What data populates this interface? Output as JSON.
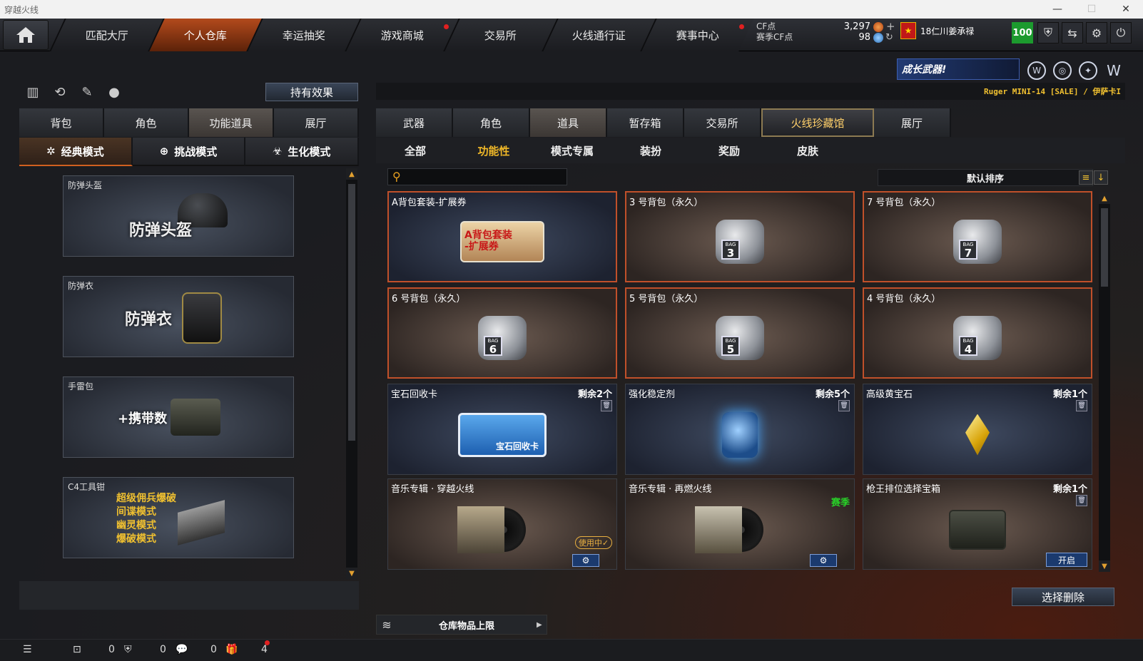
{
  "window": {
    "title": "穿越火线",
    "min": "—",
    "max": "☐",
    "close": "✕"
  },
  "nav": {
    "tabs": [
      "匹配大厅",
      "个人仓库",
      "幸运抽奖",
      "游戏商城",
      "交易所",
      "火线通行证",
      "赛事中心"
    ],
    "active_index": 1
  },
  "currency": {
    "cf_label": "CF点",
    "cf_value": "3,297",
    "season_label": "赛季CF点",
    "season_value": "98"
  },
  "player": {
    "rank_name": "18仁川姜承禄",
    "level": "100"
  },
  "left": {
    "effect_button": "持有效果",
    "tabs": [
      "背包",
      "角色",
      "功能道具",
      "展厅"
    ],
    "active_tab": 2,
    "modes": [
      "经典模式",
      "挑战模式",
      "生化模式"
    ],
    "active_mode": 0,
    "cards": [
      {
        "caption": "防弹头盔",
        "text": "防弹头盔"
      },
      {
        "caption": "防弹衣",
        "text": "防弹衣"
      },
      {
        "caption": "手雷包",
        "text": "+携带数"
      },
      {
        "caption": "C4工具钳",
        "lines": [
          "超级佣兵爆破",
          "间谍模式",
          "幽灵模式",
          "爆破模式"
        ]
      }
    ]
  },
  "right": {
    "banner": "成长武器!",
    "ticker": "Ruger MINI-14  [SALE] / 伊萨卡I",
    "tabs": [
      "武器",
      "角色",
      "道具",
      "暂存箱",
      "交易所",
      "火线珍藏馆",
      "展厅"
    ],
    "active_tab": 2,
    "subtabs": [
      "全部",
      "功能性",
      "模式专属",
      "装扮",
      "奖励",
      "皮肤"
    ],
    "active_subtab": 1,
    "search": {
      "placeholder": ""
    },
    "sort_label": "默认排序",
    "items": [
      {
        "title": "A背包套装-扩展券",
        "art": "A背包套装\n-扩展券"
      },
      {
        "title": "3 号背包（永久）",
        "bag": "3"
      },
      {
        "title": "7 号背包（永久）",
        "bag": "7"
      },
      {
        "title": "6 号背包（永久）",
        "bag": "6"
      },
      {
        "title": "5 号背包（永久）",
        "bag": "5"
      },
      {
        "title": "4 号背包（永久）",
        "bag": "4"
      },
      {
        "title": "宝石回收卡",
        "remain": "剩余2个",
        "art": "宝石回收卡"
      },
      {
        "title": "强化稳定剂",
        "remain": "剩余5个"
      },
      {
        "title": "高级黄宝石",
        "remain": "剩余1个"
      },
      {
        "title": "音乐专辑 · 穿越火线",
        "status": "使用中"
      },
      {
        "title": "音乐专辑 · 再燃火线",
        "tag": "赛季"
      },
      {
        "title": "枪王排位选择宝箱",
        "remain": "剩余1个",
        "button": "开启"
      }
    ],
    "bag_label": "BAG",
    "delete_button": "选择删除",
    "capacity_label": "仓库物品上限"
  },
  "statusbar": {
    "count1": "0",
    "count2": "0",
    "count3": "0",
    "count4": "4"
  }
}
